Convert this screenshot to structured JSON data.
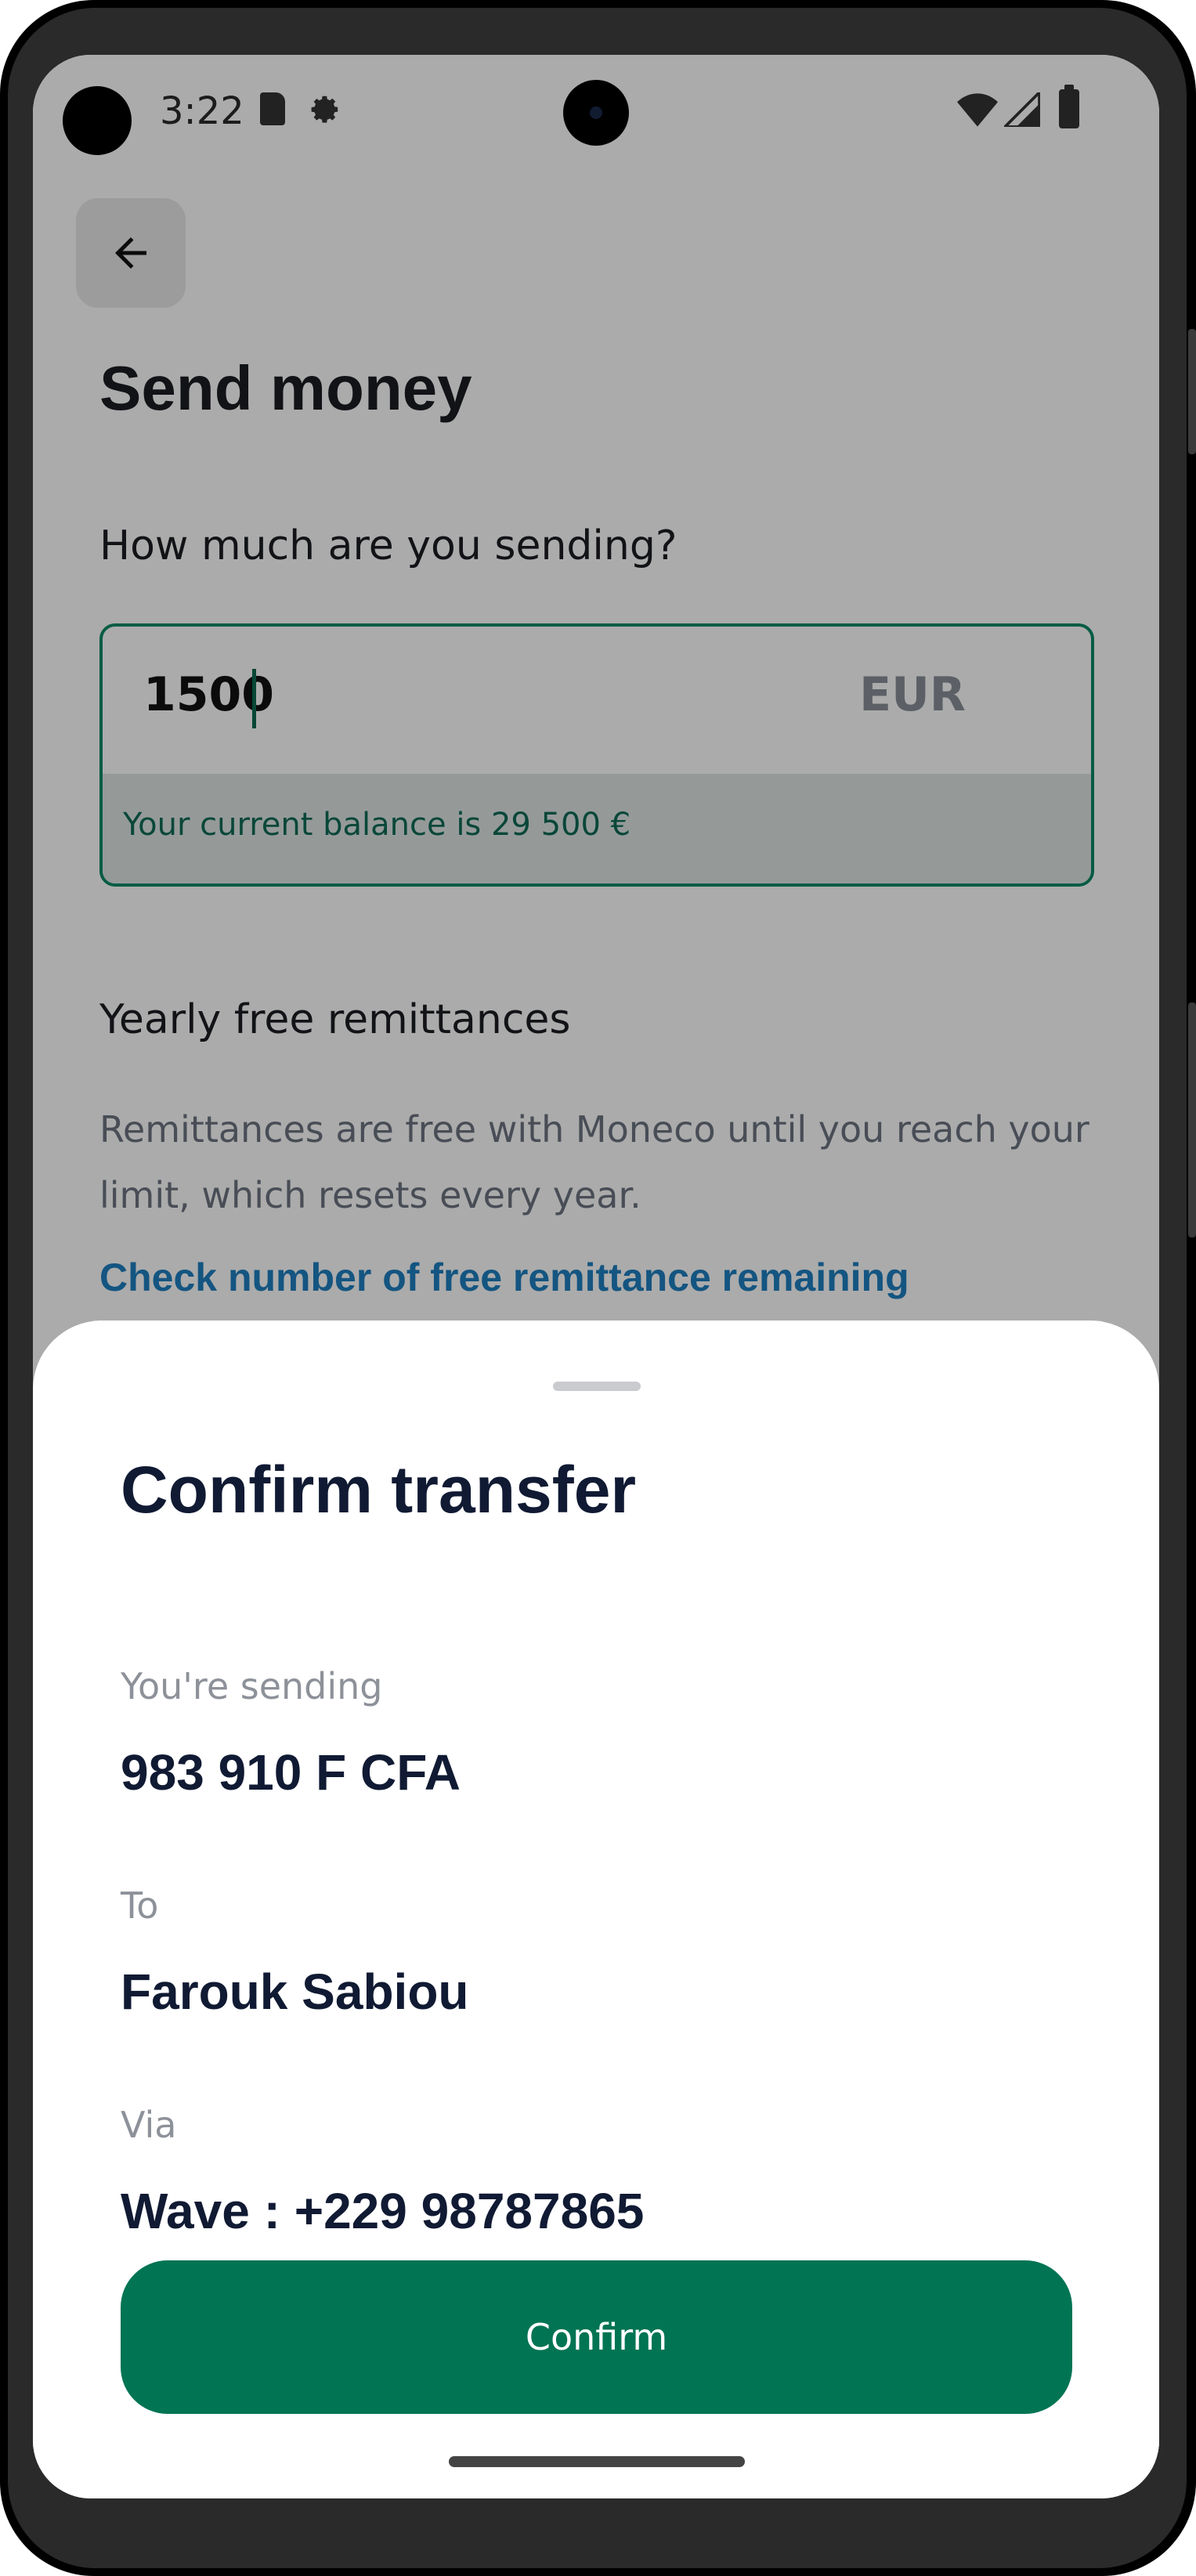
{
  "status_bar": {
    "time": "3:22",
    "icons": [
      "sd-card-icon",
      "gear-icon",
      "wifi-icon",
      "signal-icon",
      "battery-icon"
    ]
  },
  "header": {
    "back_icon": "arrow-left-icon",
    "title": "Send money"
  },
  "amount_section": {
    "question": "How much are you sending?",
    "amount_value": "1500",
    "currency": "EUR",
    "balance_text": "Your current balance is 29 500 €",
    "accent_color": "#0a8a66"
  },
  "remittances": {
    "title": "Yearly free remittances",
    "description": "Remittances are free with Moneco until you reach your limit, which resets every year.",
    "link": "Check number of free remittance remaining",
    "link_color": "#1f7fc0"
  },
  "confirm_sheet": {
    "title": "Confirm transfer",
    "sending_label": "You're sending",
    "sending_value": "983 910 F CFA",
    "to_label": "To",
    "to_value": "Farouk Sabiou",
    "via_label": "Via",
    "via_value": "Wave : +229 98787865",
    "button_label": "Confirm",
    "button_color": "#007453"
  }
}
